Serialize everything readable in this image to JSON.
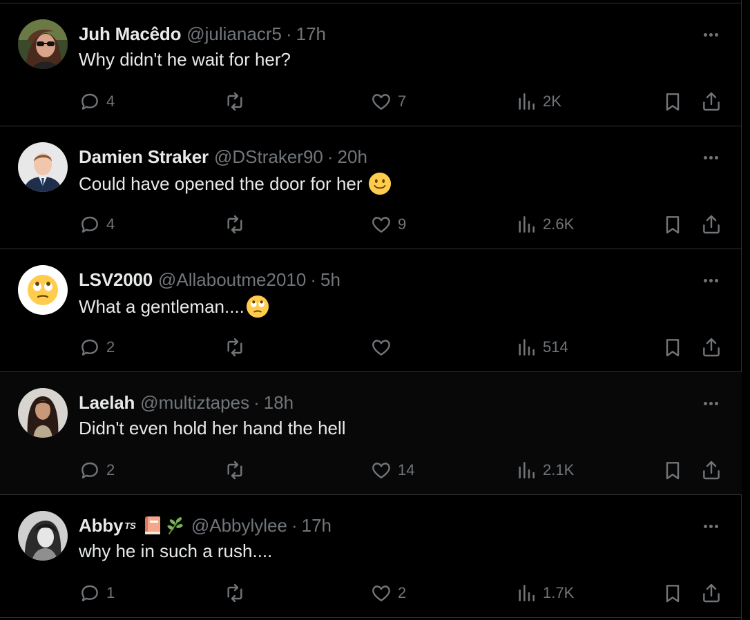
{
  "replies": [
    {
      "name": "Juh Macêdo",
      "handle": "@julianacr5",
      "separator": "·",
      "time": "17h",
      "text": "Why didn't he wait for her?",
      "reply_count": "4",
      "retweet_count": "",
      "like_count": "7",
      "view_count": "2K",
      "avatar_icon": "avatar-woman-sunglasses",
      "highlighted": false
    },
    {
      "name": "Damien Straker",
      "handle": "@DStraker90",
      "separator": "·",
      "time": "20h",
      "text": "Could have opened the door for her",
      "text_emoji": "slightly-smiling-face",
      "reply_count": "4",
      "retweet_count": "",
      "like_count": "9",
      "view_count": "2.6K",
      "avatar_icon": "avatar-man-suit",
      "highlighted": false
    },
    {
      "name": "LSV2000",
      "handle": "@Allaboutme2010",
      "separator": "·",
      "time": "5h",
      "text": "What a gentleman....",
      "text_emoji": "face-with-rolling-eyes",
      "reply_count": "2",
      "retweet_count": "",
      "like_count": "",
      "view_count": "514",
      "avatar_icon": "avatar-rolling-eyes-emoji",
      "highlighted": false
    },
    {
      "name": "Laelah",
      "handle": "@multiztapes",
      "separator": "·",
      "time": "18h",
      "text": "Didn't even hold her hand the hell",
      "reply_count": "2",
      "retweet_count": "",
      "like_count": "14",
      "view_count": "2.1K",
      "avatar_icon": "avatar-woman-long-hair",
      "highlighted": true
    },
    {
      "name": "Abby",
      "name_superscript": "TS",
      "name_badges": [
        "book-emoji",
        "herb-emoji"
      ],
      "handle": "@Abbylylee",
      "separator": "·",
      "time": "17h",
      "text": "why he in such a rush....",
      "reply_count": "1",
      "retweet_count": "",
      "like_count": "2",
      "view_count": "1.7K",
      "avatar_icon": "avatar-bw-portrait",
      "highlighted": false
    }
  ],
  "colors": {
    "background": "#000000",
    "highlight_background": "#080808",
    "text_primary": "#e7e9ea",
    "text_secondary": "#71767b",
    "divider": "#2f3336"
  }
}
